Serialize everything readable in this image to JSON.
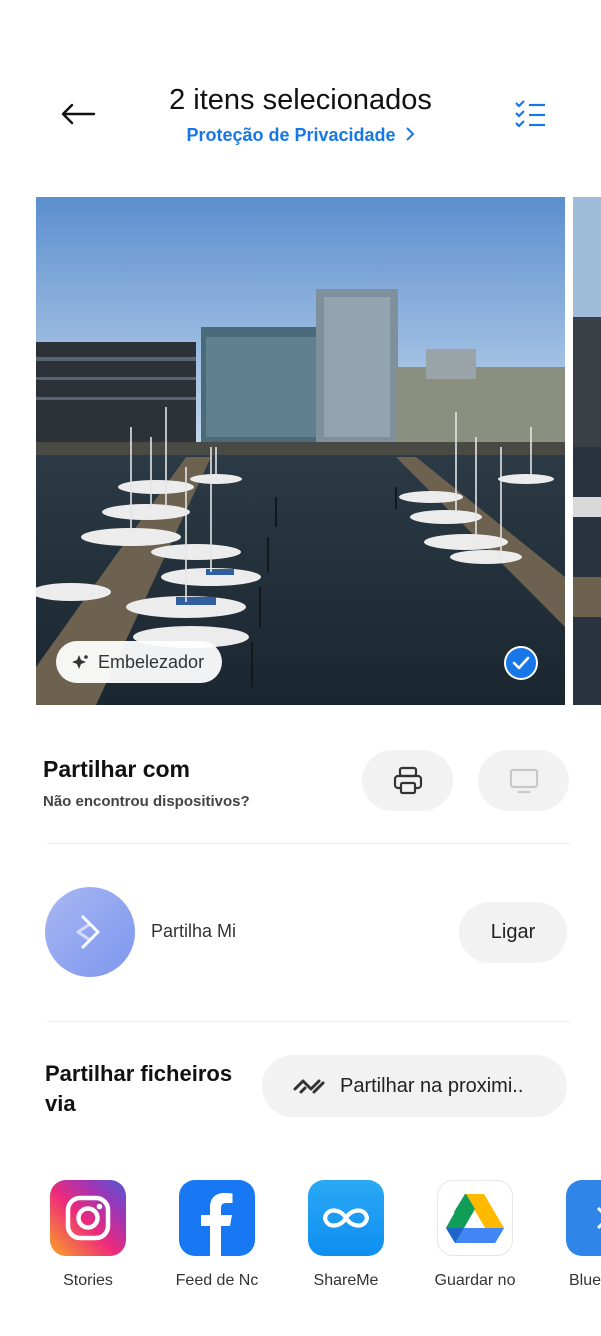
{
  "header": {
    "title": "2 itens selecionados",
    "privacy_link": "Proteção de Privacidade",
    "back_icon": "arrow-left-icon",
    "select_icon": "checklist-icon"
  },
  "photos": {
    "beautify_label": "Embelezador",
    "selected": true
  },
  "share_with": {
    "title": "Partilhar com",
    "subtitle": "Não encontrou dispositivos?",
    "devices": [
      "printer-icon",
      "monitor-icon"
    ]
  },
  "mi_share": {
    "label": "Partilha Mi",
    "connect_label": "Ligar"
  },
  "share_via": {
    "title": "Partilhar ficheiros via",
    "nearby_label": "Partilhar na proximi.."
  },
  "apps": [
    {
      "label": "Stories",
      "icon": "instagram-icon"
    },
    {
      "label": "Feed de Nc",
      "icon": "facebook-icon"
    },
    {
      "label": "ShareMe",
      "icon": "shareme-icon"
    },
    {
      "label": "Guardar no",
      "icon": "google-drive-icon"
    },
    {
      "label": "Blue",
      "icon": "bluetooth-icon"
    }
  ],
  "colors": {
    "accent": "#1877e8",
    "pill_bg": "#f2f2f2"
  }
}
